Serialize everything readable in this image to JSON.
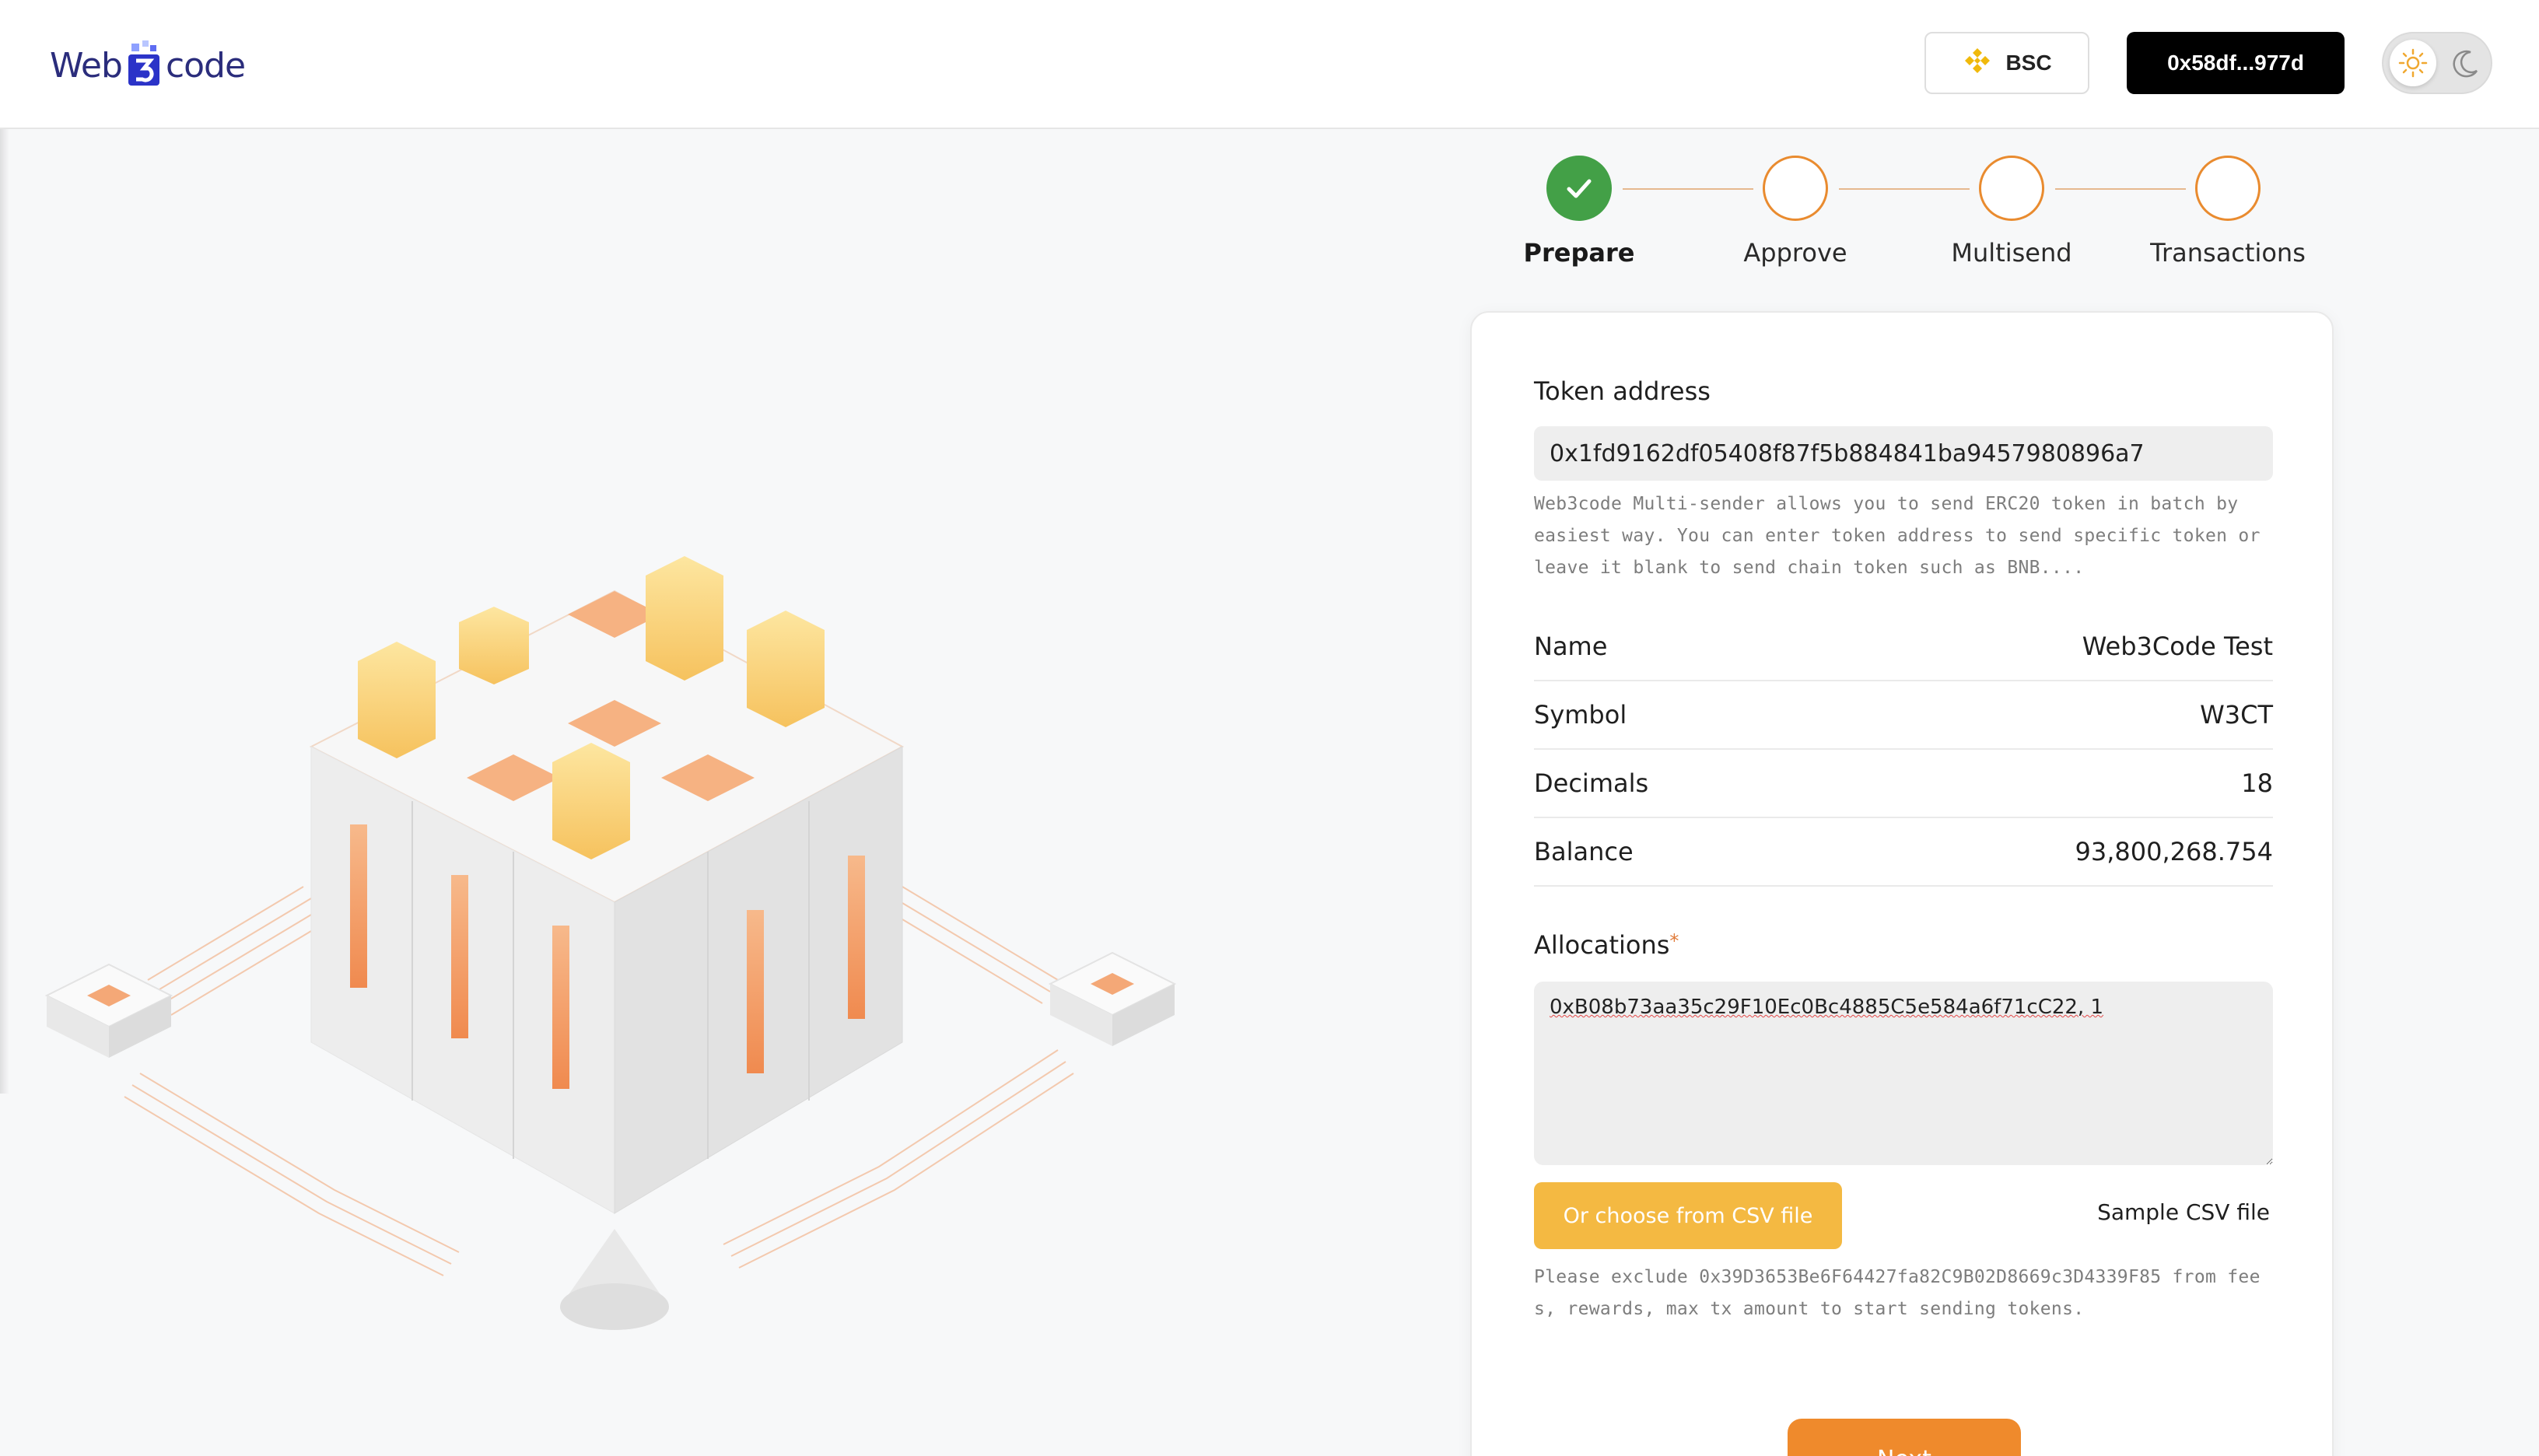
{
  "header": {
    "logo": {
      "left": "Web",
      "right": "code"
    },
    "network": {
      "label": "BSC",
      "icon": "bnb-icon"
    },
    "wallet": {
      "label": "0x58df...977d"
    },
    "theme_toggle": {
      "light_icon": "sun-icon",
      "dark_icon": "moon-icon",
      "active": "light"
    }
  },
  "stepper": {
    "steps": [
      {
        "label": "Prepare",
        "status": "done"
      },
      {
        "label": "Approve",
        "status": "pending"
      },
      {
        "label": "Multisend",
        "status": "pending"
      },
      {
        "label": "Transactions",
        "status": "pending"
      }
    ]
  },
  "form": {
    "token_address": {
      "label": "Token address",
      "value": "0x1fd9162df05408f87f5b884841ba9457980896a7",
      "help": "Web3code Multi-sender allows you to send ERC20 token in batch by easiest way. You can enter token address to send specific token or leave it blank to send chain token such as BNB...."
    },
    "token_info": [
      {
        "label": "Name",
        "value": "Web3Code Test"
      },
      {
        "label": "Symbol",
        "value": "W3CT"
      },
      {
        "label": "Decimals",
        "value": "18"
      },
      {
        "label": "Balance",
        "value": "93,800,268.754"
      }
    ],
    "allocations": {
      "label": "Allocations",
      "required_mark": "*",
      "value": "0xB08b73aa35c29F10Ec0Bc4885C5e584a6f71cC22, 1"
    },
    "csv_button": "Or choose from CSV file",
    "sample_link": "Sample CSV file",
    "exclude_note": "Please exclude 0x39D3653Be6F64427fa82C9B02D8669c3D4339F85 from fees, rewards, max tx amount to start sending tokens.",
    "next_button": "Next"
  },
  "colors": {
    "accent_orange": "#ef8a2c",
    "csv_yellow": "#f4b942",
    "step_done_green": "#43a047",
    "logo_navy": "#2b2d7c"
  }
}
